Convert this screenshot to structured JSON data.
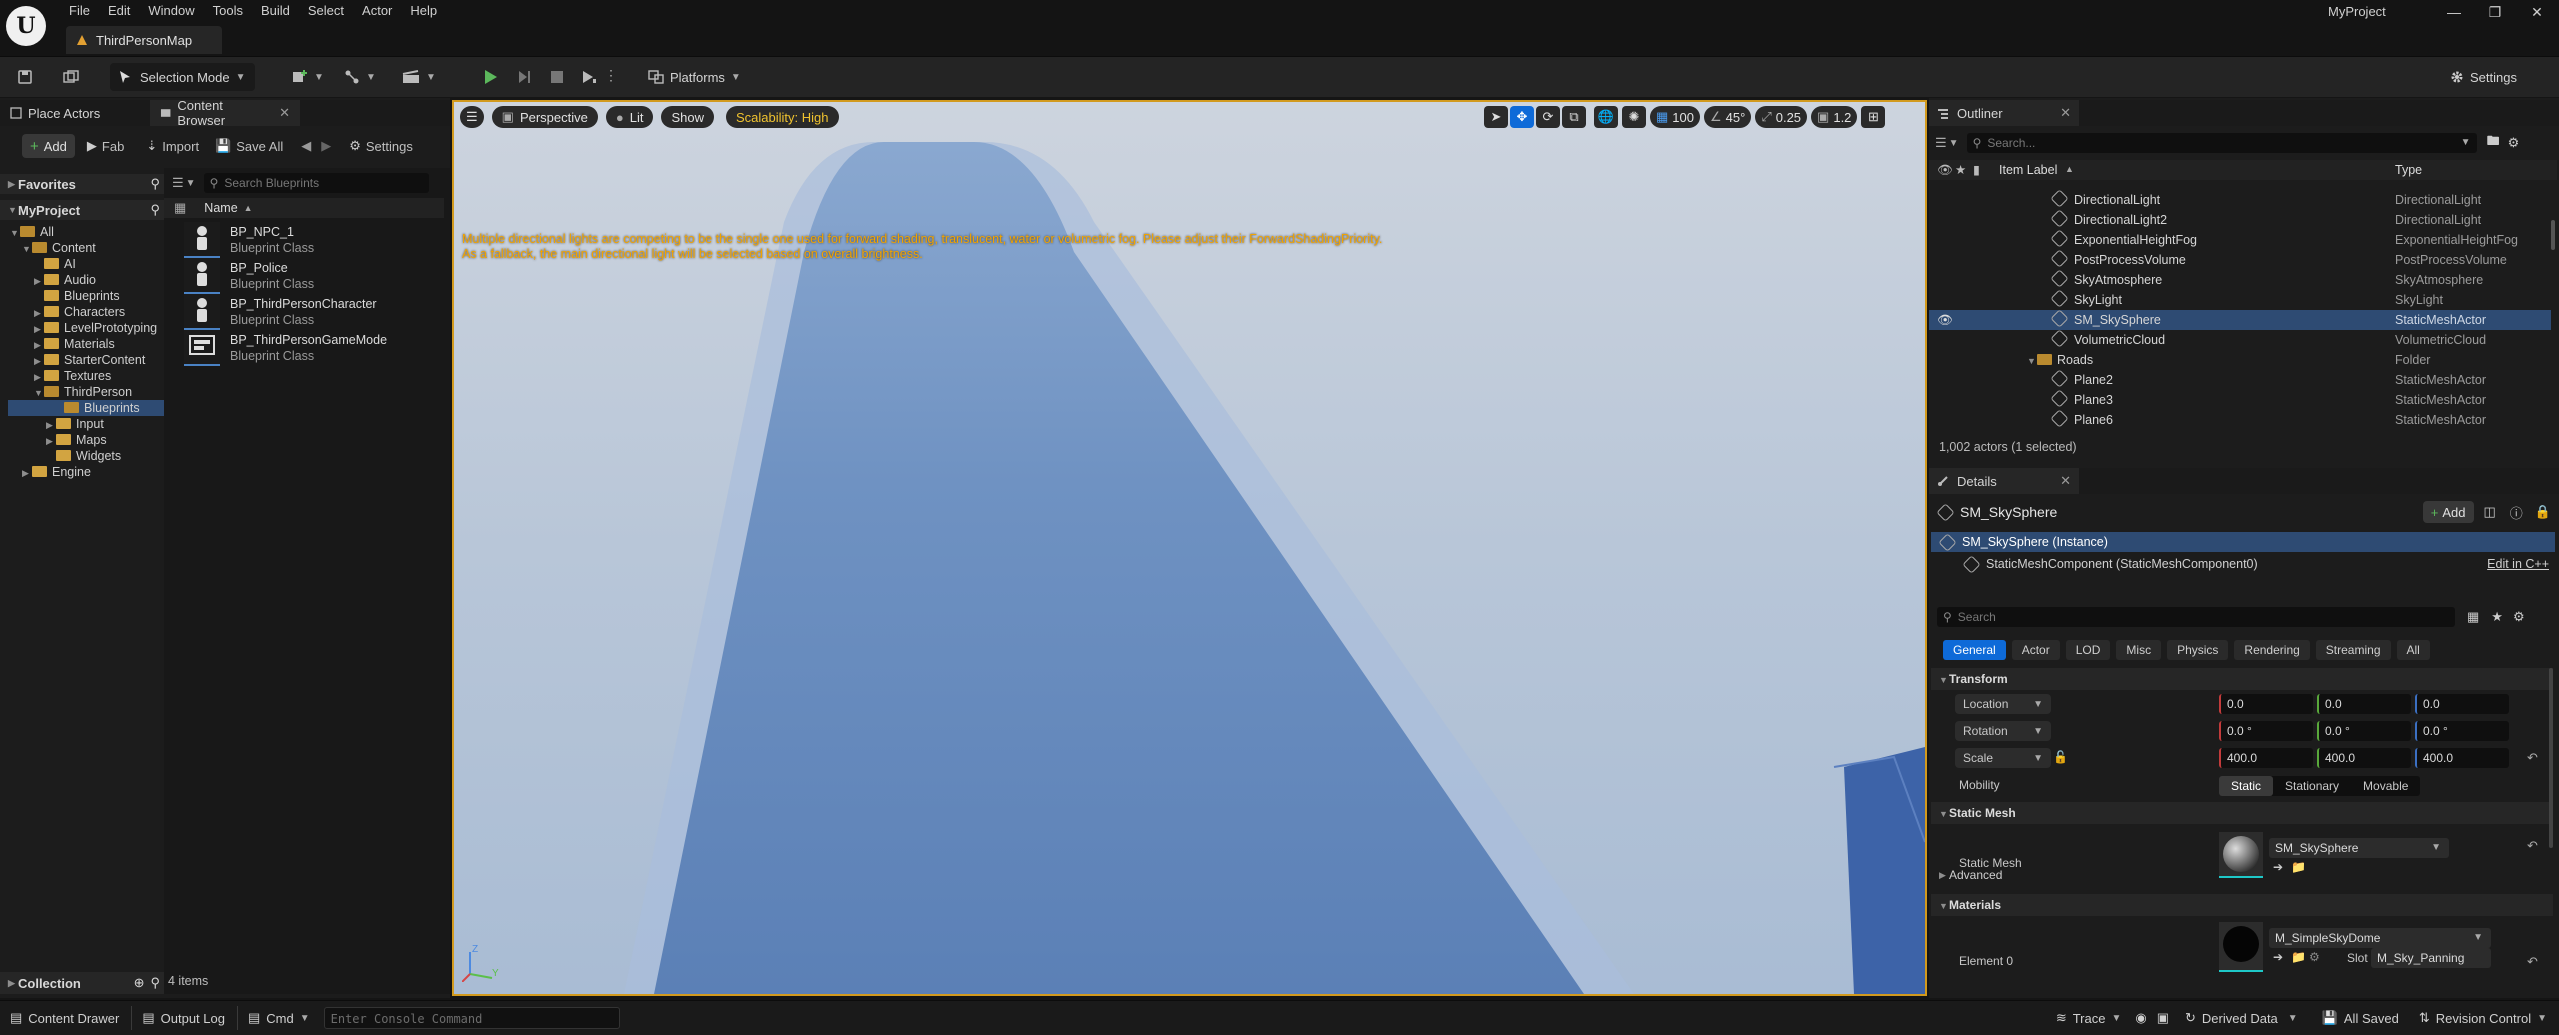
{
  "app": {
    "logo": "U",
    "project_name": "MyProject",
    "map_tab": "ThirdPersonMap"
  },
  "menu": [
    "File",
    "Edit",
    "Window",
    "Tools",
    "Build",
    "Select",
    "Actor",
    "Help"
  ],
  "toolbar": {
    "mode": "Selection Mode",
    "platforms": "Platforms",
    "settings": "Settings"
  },
  "left_tabs": {
    "place_actors": "Place Actors",
    "content_browser": "Content Browser"
  },
  "content_browser": {
    "add": "Add",
    "fab": "Fab",
    "import": "Import",
    "save_all": "Save All",
    "settings": "Settings",
    "favorites": "Favorites",
    "project": "MyProject",
    "search_placeholder": "Search Blueprints",
    "name_header": "Name",
    "collection": "Collection",
    "item_count": "4 items",
    "tree": [
      "All",
      "Content",
      "AI",
      "Audio",
      "Blueprints",
      "Characters",
      "LevelPrototyping",
      "Materials",
      "StarterContent",
      "Textures",
      "ThirdPerson",
      "Blueprints",
      "Input",
      "Maps",
      "Widgets",
      "Engine"
    ],
    "assets": [
      {
        "name": "BP_NPC_1",
        "class": "Blueprint Class"
      },
      {
        "name": "BP_Police",
        "class": "Blueprint Class"
      },
      {
        "name": "BP_ThirdPersonCharacter",
        "class": "Blueprint Class"
      },
      {
        "name": "BP_ThirdPersonGameMode",
        "class": "Blueprint Class"
      }
    ]
  },
  "viewport": {
    "perspective": "Perspective",
    "lit": "Lit",
    "show": "Show",
    "scalability": "Scalability: High",
    "grid": "100",
    "angle": "45°",
    "scale": "0.25",
    "camera": "1.2",
    "warning_line1": "Multiple directional lights are competing to be the single one used for forward shading, translucent, water or volumetric fog. Please adjust their ForwardShadingPriority.",
    "warning_line2": "As a fallback, the main directional light will be selected based on overall brightness."
  },
  "outliner": {
    "title": "Outliner",
    "search_placeholder": "Search...",
    "col_label": "Item Label",
    "col_type": "Type",
    "rows": [
      {
        "label": "DirectionalLight",
        "type": "DirectionalLight"
      },
      {
        "label": "DirectionalLight2",
        "type": "DirectionalLight"
      },
      {
        "label": "ExponentialHeightFog",
        "type": "ExponentialHeightFog"
      },
      {
        "label": "PostProcessVolume",
        "type": "PostProcessVolume"
      },
      {
        "label": "SkyAtmosphere",
        "type": "SkyAtmosphere"
      },
      {
        "label": "SkyLight",
        "type": "SkyLight"
      },
      {
        "label": "SM_SkySphere",
        "type": "StaticMeshActor"
      },
      {
        "label": "VolumetricCloud",
        "type": "VolumetricCloud"
      },
      {
        "label": "Roads",
        "type": "Folder"
      },
      {
        "label": "Plane2",
        "type": "StaticMeshActor"
      },
      {
        "label": "Plane3",
        "type": "StaticMeshActor"
      },
      {
        "label": "Plane6",
        "type": "StaticMeshActor"
      }
    ],
    "status": "1,002 actors (1 selected)"
  },
  "details": {
    "title": "Details",
    "actor": "SM_SkySphere",
    "add": "Add",
    "instance": "SM_SkySphere (Instance)",
    "component": "StaticMeshComponent (StaticMeshComponent0)",
    "edit_cpp": "Edit in C++",
    "search_placeholder": "Search",
    "filters": [
      "General",
      "Actor",
      "LOD",
      "Misc",
      "Physics",
      "Rendering",
      "Streaming",
      "All"
    ],
    "transform": "Transform",
    "location": {
      "label": "Location",
      "x": "0.0",
      "y": "0.0",
      "z": "0.0"
    },
    "rotation": {
      "label": "Rotation",
      "x": "0.0 °",
      "y": "0.0 °",
      "z": "0.0 °"
    },
    "scale": {
      "label": "Scale",
      "x": "400.0",
      "y": "400.0",
      "z": "400.0"
    },
    "mobility": {
      "label": "Mobility",
      "options": [
        "Static",
        "Stationary",
        "Movable"
      ]
    },
    "static_mesh_cat": "Static Mesh",
    "static_mesh_label": "Static Mesh",
    "static_mesh_value": "SM_SkySphere",
    "advanced": "Advanced",
    "materials_cat": "Materials",
    "element0": "Element 0",
    "material_value": "M_SimpleSkyDome",
    "slot_label": "Slot",
    "slot_value": "M_Sky_Panning"
  },
  "statusbar": {
    "content_drawer": "Content Drawer",
    "output_log": "Output Log",
    "cmd": "Cmd",
    "console_placeholder": "Enter Console Command",
    "trace": "Trace",
    "derived_data": "Derived Data",
    "all_saved": "All Saved",
    "revision_control": "Revision Control"
  },
  "colors": {
    "accent": "#0e6ad8",
    "selection": "#2e4b73",
    "viewport_border": "#d29a1e",
    "warning": "#f2a400",
    "play": "#5cb85c"
  }
}
